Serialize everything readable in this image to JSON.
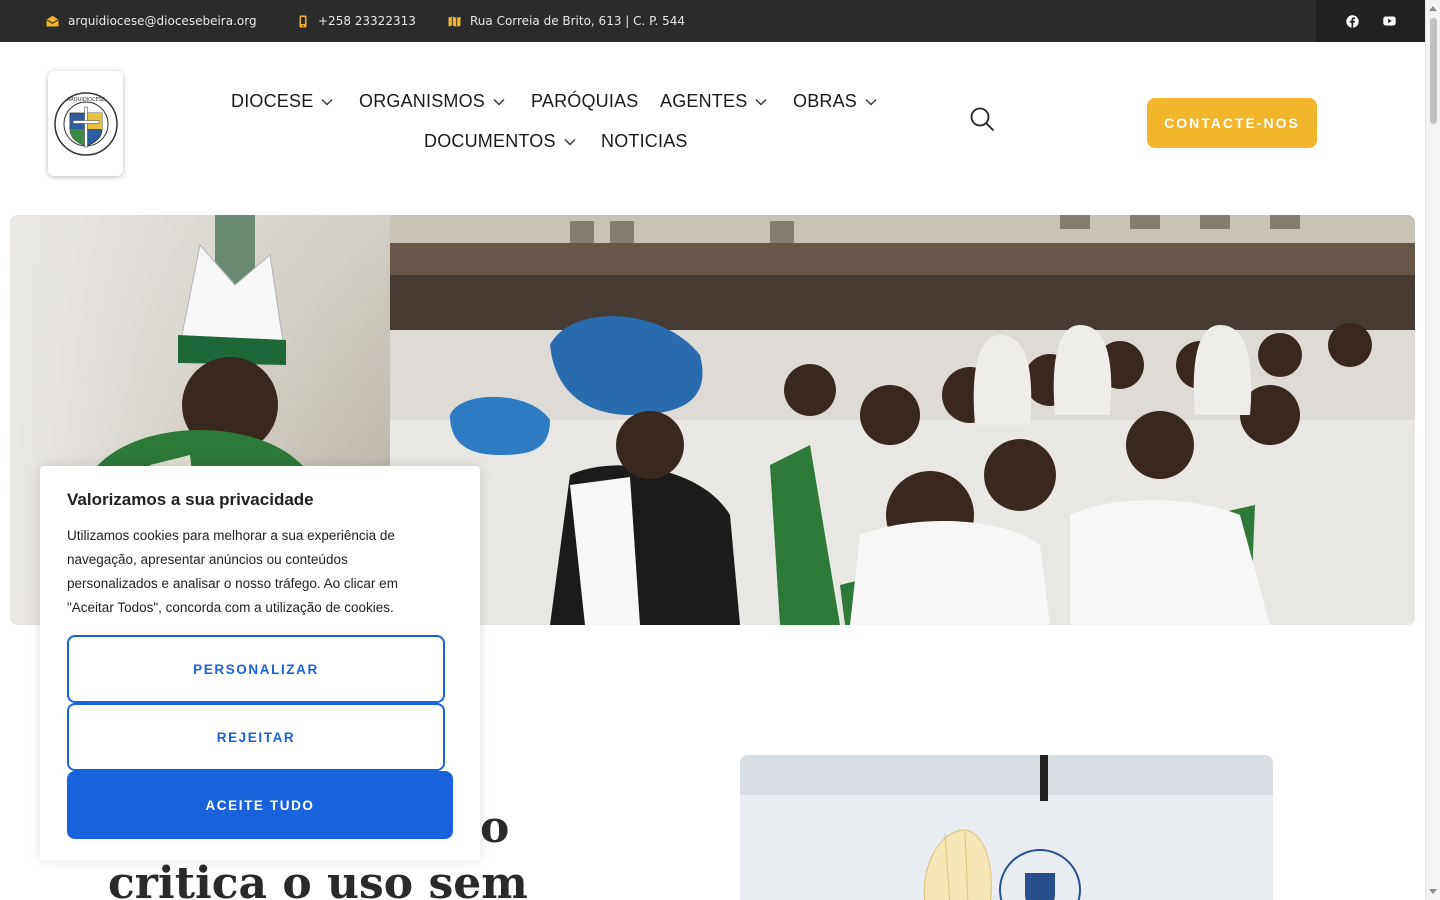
{
  "topbar": {
    "email": "arquidiocese@diocesebeira.org",
    "phone": "+258 23322313",
    "address": "Rua Correia de Brito, 613 | C. P. 544",
    "icons": [
      "envelope-icon",
      "phone-icon",
      "map-icon",
      "facebook-icon",
      "youtube-icon"
    ]
  },
  "header": {
    "logo_alt": "Arquidiocese da Beira logo",
    "nav": [
      "DIOCESE",
      "ORGANISMOS",
      "PARÓQUIAS",
      "AGENTES",
      "OBRAS",
      "DOCUMENTOS",
      "NOTICIAS"
    ],
    "cta_label": "CONTACTE-NOS",
    "colors": {
      "accent": "#f2b52c",
      "topbar": "#2b2b2b"
    }
  },
  "hero": {
    "alt": "Bishop with mitre blessing a crowd of religious sisters and priests"
  },
  "article": {
    "heading_line1_fragment": "no",
    "heading_line2_fragment": "critica o uso sem"
  },
  "cookie": {
    "title": "Valorizamos a sua privacidade",
    "body": "Utilizamos cookies para melhorar a sua experiência de navegação, apresentar anúncios ou conteúdos personalizados e analisar o nosso tráfego. Ao clicar em \"Aceitar Todos\", concorda com a utilização de cookies.",
    "customize_label": "PERSONALIZAR",
    "reject_label": "REJEITAR",
    "accept_label": "ACEITE TUDO",
    "colors": {
      "primary": "#1863dc"
    }
  }
}
